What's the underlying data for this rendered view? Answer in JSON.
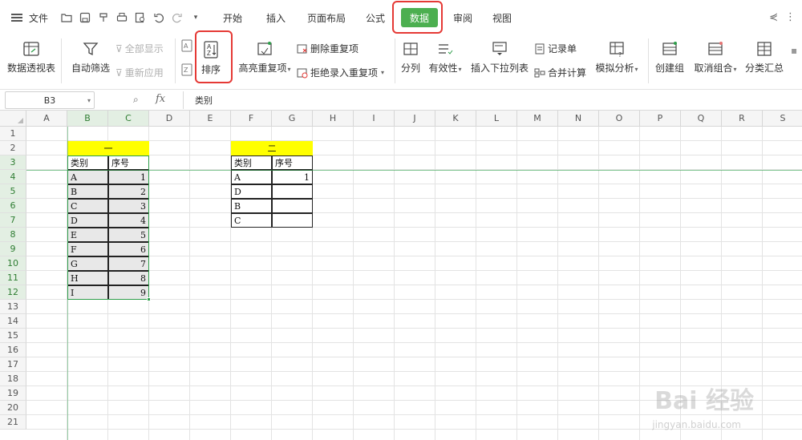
{
  "menu": {
    "file": "文件",
    "tabs": [
      "开始",
      "插入",
      "页面布局",
      "公式",
      "数据",
      "审阅",
      "视图"
    ],
    "active_tab": "数据"
  },
  "ribbon": {
    "pivot": "数据透视表",
    "autofilter": "自动筛选",
    "show_all": "全部显示",
    "reapply": "重新应用",
    "sort": "排序",
    "highlight_dup": "高亮重复项",
    "delete_dup": "删除重复项",
    "reject_dup": "拒绝录入重复项",
    "split": "分列",
    "validity": "有效性",
    "insert_dropdown": "插入下拉列表",
    "record_form": "记录单",
    "consolidate": "合并计算",
    "what_if": "模拟分析",
    "group": "创建组",
    "ungroup": "取消组合",
    "subtotal": "分类汇总"
  },
  "formula_bar": {
    "name_box": "B3",
    "fx": "fx",
    "content": "类别"
  },
  "columns": [
    "A",
    "B",
    "C",
    "D",
    "E",
    "F",
    "G",
    "H",
    "I",
    "J",
    "K",
    "L",
    "M",
    "N",
    "O",
    "P",
    "Q",
    "R",
    "S"
  ],
  "rows": [
    "1",
    "2",
    "3",
    "4",
    "5",
    "6",
    "7",
    "8",
    "9",
    "10",
    "11",
    "12",
    "13",
    "14",
    "15",
    "16",
    "17",
    "18",
    "19",
    "20",
    "21"
  ],
  "table1": {
    "title": "一",
    "headers": [
      "类别",
      "序号"
    ],
    "rows": [
      [
        "A",
        "1"
      ],
      [
        "B",
        "2"
      ],
      [
        "C",
        "3"
      ],
      [
        "D",
        "4"
      ],
      [
        "E",
        "5"
      ],
      [
        "F",
        "6"
      ],
      [
        "G",
        "7"
      ],
      [
        "H",
        "8"
      ],
      [
        "I",
        "9"
      ]
    ]
  },
  "table2": {
    "title": "二",
    "headers": [
      "类别",
      "序号"
    ],
    "rows": [
      [
        "A",
        "1"
      ],
      [
        "D",
        ""
      ],
      [
        "B",
        ""
      ],
      [
        "C",
        ""
      ]
    ]
  },
  "watermark": {
    "logo": "Bai 经验",
    "url": "jingyan.baidu.com"
  },
  "colors": {
    "accent": "#4caf50",
    "highlight_box": "#e53935",
    "selection": "#2e9e4a",
    "title_fill": "#ffff00"
  }
}
